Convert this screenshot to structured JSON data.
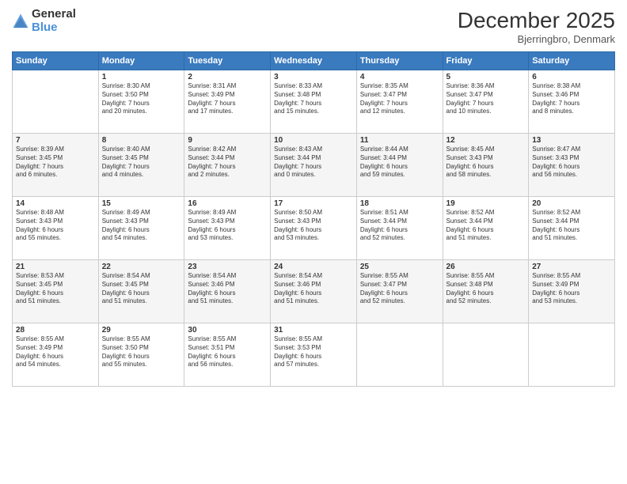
{
  "logo": {
    "general": "General",
    "blue": "Blue"
  },
  "title": "December 2025",
  "subtitle": "Bjerringbro, Denmark",
  "weekdays": [
    "Sunday",
    "Monday",
    "Tuesday",
    "Wednesday",
    "Thursday",
    "Friday",
    "Saturday"
  ],
  "weeks": [
    [
      {
        "day": "",
        "info": ""
      },
      {
        "day": "1",
        "info": "Sunrise: 8:30 AM\nSunset: 3:50 PM\nDaylight: 7 hours\nand 20 minutes."
      },
      {
        "day": "2",
        "info": "Sunrise: 8:31 AM\nSunset: 3:49 PM\nDaylight: 7 hours\nand 17 minutes."
      },
      {
        "day": "3",
        "info": "Sunrise: 8:33 AM\nSunset: 3:48 PM\nDaylight: 7 hours\nand 15 minutes."
      },
      {
        "day": "4",
        "info": "Sunrise: 8:35 AM\nSunset: 3:47 PM\nDaylight: 7 hours\nand 12 minutes."
      },
      {
        "day": "5",
        "info": "Sunrise: 8:36 AM\nSunset: 3:47 PM\nDaylight: 7 hours\nand 10 minutes."
      },
      {
        "day": "6",
        "info": "Sunrise: 8:38 AM\nSunset: 3:46 PM\nDaylight: 7 hours\nand 8 minutes."
      }
    ],
    [
      {
        "day": "7",
        "info": "Sunrise: 8:39 AM\nSunset: 3:45 PM\nDaylight: 7 hours\nand 6 minutes."
      },
      {
        "day": "8",
        "info": "Sunrise: 8:40 AM\nSunset: 3:45 PM\nDaylight: 7 hours\nand 4 minutes."
      },
      {
        "day": "9",
        "info": "Sunrise: 8:42 AM\nSunset: 3:44 PM\nDaylight: 7 hours\nand 2 minutes."
      },
      {
        "day": "10",
        "info": "Sunrise: 8:43 AM\nSunset: 3:44 PM\nDaylight: 7 hours\nand 0 minutes."
      },
      {
        "day": "11",
        "info": "Sunrise: 8:44 AM\nSunset: 3:44 PM\nDaylight: 6 hours\nand 59 minutes."
      },
      {
        "day": "12",
        "info": "Sunrise: 8:45 AM\nSunset: 3:43 PM\nDaylight: 6 hours\nand 58 minutes."
      },
      {
        "day": "13",
        "info": "Sunrise: 8:47 AM\nSunset: 3:43 PM\nDaylight: 6 hours\nand 56 minutes."
      }
    ],
    [
      {
        "day": "14",
        "info": "Sunrise: 8:48 AM\nSunset: 3:43 PM\nDaylight: 6 hours\nand 55 minutes."
      },
      {
        "day": "15",
        "info": "Sunrise: 8:49 AM\nSunset: 3:43 PM\nDaylight: 6 hours\nand 54 minutes."
      },
      {
        "day": "16",
        "info": "Sunrise: 8:49 AM\nSunset: 3:43 PM\nDaylight: 6 hours\nand 53 minutes."
      },
      {
        "day": "17",
        "info": "Sunrise: 8:50 AM\nSunset: 3:43 PM\nDaylight: 6 hours\nand 53 minutes."
      },
      {
        "day": "18",
        "info": "Sunrise: 8:51 AM\nSunset: 3:44 PM\nDaylight: 6 hours\nand 52 minutes."
      },
      {
        "day": "19",
        "info": "Sunrise: 8:52 AM\nSunset: 3:44 PM\nDaylight: 6 hours\nand 51 minutes."
      },
      {
        "day": "20",
        "info": "Sunrise: 8:52 AM\nSunset: 3:44 PM\nDaylight: 6 hours\nand 51 minutes."
      }
    ],
    [
      {
        "day": "21",
        "info": "Sunrise: 8:53 AM\nSunset: 3:45 PM\nDaylight: 6 hours\nand 51 minutes."
      },
      {
        "day": "22",
        "info": "Sunrise: 8:54 AM\nSunset: 3:45 PM\nDaylight: 6 hours\nand 51 minutes."
      },
      {
        "day": "23",
        "info": "Sunrise: 8:54 AM\nSunset: 3:46 PM\nDaylight: 6 hours\nand 51 minutes."
      },
      {
        "day": "24",
        "info": "Sunrise: 8:54 AM\nSunset: 3:46 PM\nDaylight: 6 hours\nand 51 minutes."
      },
      {
        "day": "25",
        "info": "Sunrise: 8:55 AM\nSunset: 3:47 PM\nDaylight: 6 hours\nand 52 minutes."
      },
      {
        "day": "26",
        "info": "Sunrise: 8:55 AM\nSunset: 3:48 PM\nDaylight: 6 hours\nand 52 minutes."
      },
      {
        "day": "27",
        "info": "Sunrise: 8:55 AM\nSunset: 3:49 PM\nDaylight: 6 hours\nand 53 minutes."
      }
    ],
    [
      {
        "day": "28",
        "info": "Sunrise: 8:55 AM\nSunset: 3:49 PM\nDaylight: 6 hours\nand 54 minutes."
      },
      {
        "day": "29",
        "info": "Sunrise: 8:55 AM\nSunset: 3:50 PM\nDaylight: 6 hours\nand 55 minutes."
      },
      {
        "day": "30",
        "info": "Sunrise: 8:55 AM\nSunset: 3:51 PM\nDaylight: 6 hours\nand 56 minutes."
      },
      {
        "day": "31",
        "info": "Sunrise: 8:55 AM\nSunset: 3:53 PM\nDaylight: 6 hours\nand 57 minutes."
      },
      {
        "day": "",
        "info": ""
      },
      {
        "day": "",
        "info": ""
      },
      {
        "day": "",
        "info": ""
      }
    ]
  ]
}
